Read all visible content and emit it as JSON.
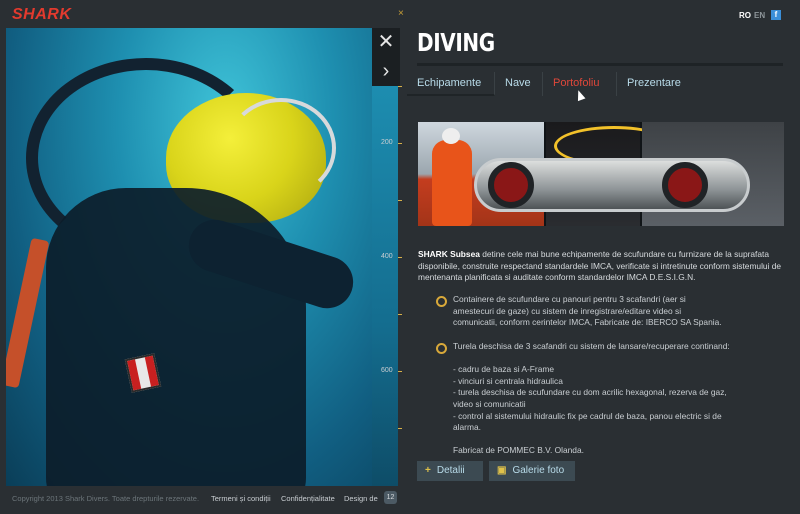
{
  "brand": {
    "logo_text": "SHARK"
  },
  "language": {
    "active": "RO",
    "inactive": "EN"
  },
  "social": {
    "facebook_glyph": "f"
  },
  "page": {
    "title": "DIVING"
  },
  "photo_controls": {
    "close_glyph": "✕",
    "next_glyph": "›"
  },
  "ruler": {
    "labels": [
      "200",
      "400",
      "600"
    ]
  },
  "tabs": [
    {
      "label": "Echipamente"
    },
    {
      "label": "Nave"
    },
    {
      "label": "Portofoliu"
    },
    {
      "label": "Prezentare"
    }
  ],
  "intro": {
    "bold": "SHARK Subsea",
    "text": " detine cele mai bune echipamente de scufundare cu furnizare de la suprafata disponibile, construite respectand standardele IMCA, verificate si intretinute conform sistemului de mentenanta planificata si auditate conform standardelor IMCA D.E.S.I.G.N."
  },
  "list": [
    {
      "lines": [
        "Containere de scufundare cu panouri pentru 3 scafandri (aer si",
        "amestecuri de gaze) cu sistem de inregistrare/editare video si",
        "comunicatii, conform cerintelor IMCA, Fabricate de: IBERCO SA Spania."
      ]
    },
    {
      "lines": [
        "Turela deschisa de 3 scafandri cu sistem de lansare/recuperare continand:",
        "",
        "- cadru de baza si A-Frame",
        "- vinciuri si centrala hidraulica",
        "- turela deschisa de scufundare cu dom acrilic hexagonal, rezerva de gaz,",
        "video si comunicatii",
        "- control al sistemului hidraulic fix pe cadrul de baza, panou electric si de",
        "alarma.",
        "",
        "Fabricat de POMMEC B.V. Olanda."
      ]
    }
  ],
  "buttons": {
    "details": {
      "icon": "+",
      "label": "Detalii"
    },
    "gallery": {
      "icon": "▣",
      "label": "Galerie foto"
    }
  },
  "footer": {
    "copyright": "Copyright 2013 Shark Divers. Toate drepturile rezervate.",
    "terms": "Termeni și condiții",
    "privacy": "Confidențialitate",
    "design": "Design de",
    "design_badge": "12"
  },
  "colors": {
    "accent": "#d9a93a",
    "brand_red": "#e23a2e",
    "active_tab": "#e0473a",
    "link": "#b8dbe9"
  }
}
